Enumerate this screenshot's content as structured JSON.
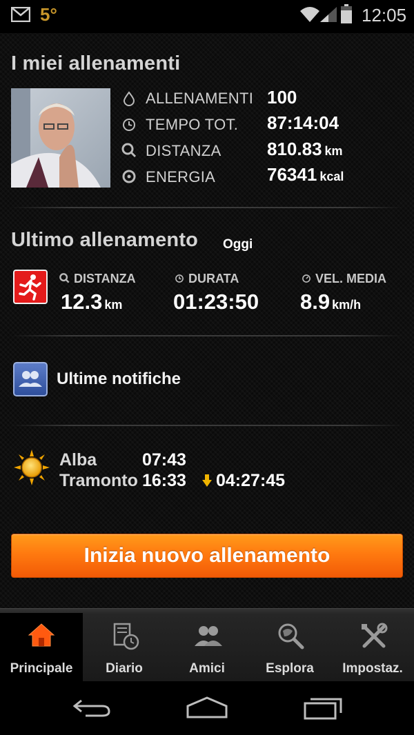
{
  "status_bar": {
    "temperature": "5°",
    "time": "12:05",
    "icons": [
      "gmail-icon",
      "wifi-icon",
      "signal-icon",
      "battery-icon"
    ]
  },
  "profile": {
    "title": "I miei allenamenti",
    "stats": [
      {
        "icon": "drop-icon",
        "label": "ALLENAMENTI",
        "value": "100",
        "unit": ""
      },
      {
        "icon": "clock-icon",
        "label": "TEMPO TOT.",
        "value": "87:14:04",
        "unit": ""
      },
      {
        "icon": "distance-icon",
        "label": "DISTANZA",
        "value": "810.83",
        "unit": "km"
      },
      {
        "icon": "energy-icon",
        "label": "ENERGIA",
        "value": "76341",
        "unit": "kcal"
      }
    ]
  },
  "last_workout": {
    "title": "Ultimo allenamento",
    "when": "Oggi",
    "distance": {
      "label": "DISTANZA",
      "value": "12.3",
      "unit": "km"
    },
    "duration": {
      "label": "DURATA",
      "value": "01:23:50",
      "unit": ""
    },
    "avg_speed": {
      "label": "VEL. MEDIA",
      "value": "8.9",
      "unit": "km/h"
    }
  },
  "notifications": {
    "label": "Ultime notifiche"
  },
  "sun": {
    "sunrise_label": "Alba",
    "sunrise": "07:43",
    "sunset_label": "Tramonto",
    "sunset": "16:33",
    "day_length": "04:27:45"
  },
  "start_button": {
    "label": "Inizia nuovo allenamento"
  },
  "tabs": [
    {
      "label": "Principale",
      "icon": "home-icon",
      "active": true
    },
    {
      "label": "Diario",
      "icon": "diary-icon",
      "active": false
    },
    {
      "label": "Amici",
      "icon": "friends-icon",
      "active": false
    },
    {
      "label": "Esplora",
      "icon": "explore-icon",
      "active": false
    },
    {
      "label": "Impostaz.",
      "icon": "settings-icon",
      "active": false
    }
  ],
  "colors": {
    "accent": "#ff7a10",
    "active_tab_icon": "#ff5a10",
    "run_badge": "#e41b1b"
  }
}
